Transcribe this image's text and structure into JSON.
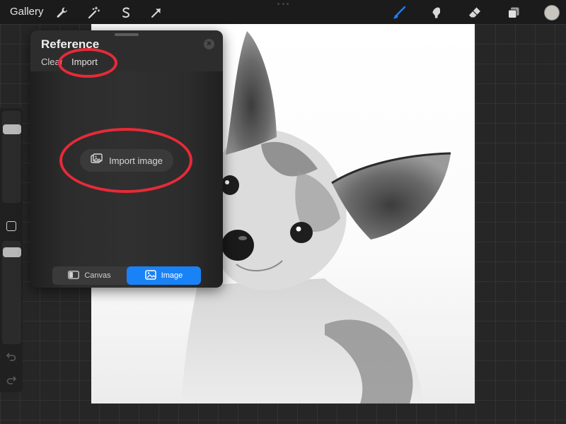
{
  "topbar": {
    "gallery_label": "Gallery",
    "left_tools": [
      "wrench-icon",
      "magic-wand-icon",
      "selection-icon",
      "transform-arrow-icon"
    ],
    "right_tools": [
      "brush-icon",
      "smudge-icon",
      "eraser-icon",
      "layers-icon"
    ],
    "active_tool": "brush-icon",
    "accent_color": "#1a82f7",
    "current_color": "#c8c6bf"
  },
  "sidebar": {
    "brush_size_level": 0.16,
    "opacity_level": 0.19
  },
  "reference_panel": {
    "title": "Reference",
    "close_label": "×",
    "tabs": {
      "clear_label": "Clear",
      "import_label": "Import"
    },
    "import_image_label": "Import image",
    "segment": {
      "canvas_label": "Canvas",
      "image_label": "Image",
      "selected": "Image"
    }
  },
  "annotations": {
    "color": "#e82a38"
  }
}
